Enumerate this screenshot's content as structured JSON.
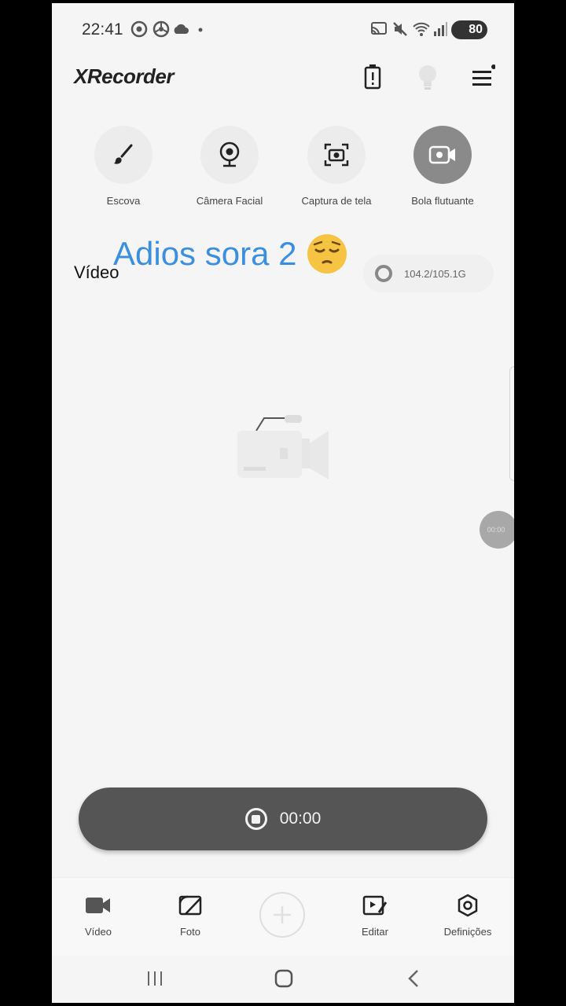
{
  "status_bar": {
    "time": "22:41",
    "battery": "80",
    "left_icons": [
      "settings-gear-icon",
      "chrome-icon",
      "cloud-icon",
      "dot-icon"
    ],
    "right_icons": [
      "cast-icon",
      "mute-icon",
      "wifi-icon",
      "signal-icon"
    ]
  },
  "header": {
    "logo": "XRecorder",
    "icons": [
      "battery-alert-icon",
      "lightbulb-icon",
      "menu-icon"
    ]
  },
  "tools": [
    {
      "label": "Escova",
      "icon": "brush-icon"
    },
    {
      "label": "Câmera Facial",
      "icon": "webcam-icon"
    },
    {
      "label": "Captura de tela",
      "icon": "screenshot-camera-icon"
    },
    {
      "label": "Bola flutuante",
      "icon": "floating-video-icon"
    }
  ],
  "overlay_caption": "Adios sora 2",
  "section": {
    "title": "Vídeo",
    "storage": "104.2/105.1G"
  },
  "float_ball_text": "00:00",
  "record": {
    "time": "00:00"
  },
  "bottom_nav": [
    {
      "label": "Vídeo",
      "icon": "video-camera-icon"
    },
    {
      "label": "Foto",
      "icon": "photo-icon"
    },
    {
      "label": "",
      "icon": "add-icon"
    },
    {
      "label": "Editar",
      "icon": "edit-video-icon"
    },
    {
      "label": "Definições",
      "icon": "settings-icon"
    }
  ],
  "colors": {
    "accent_caption": "#3b8fe0",
    "record_bar": "#555555",
    "background": "#f5f5f5"
  }
}
